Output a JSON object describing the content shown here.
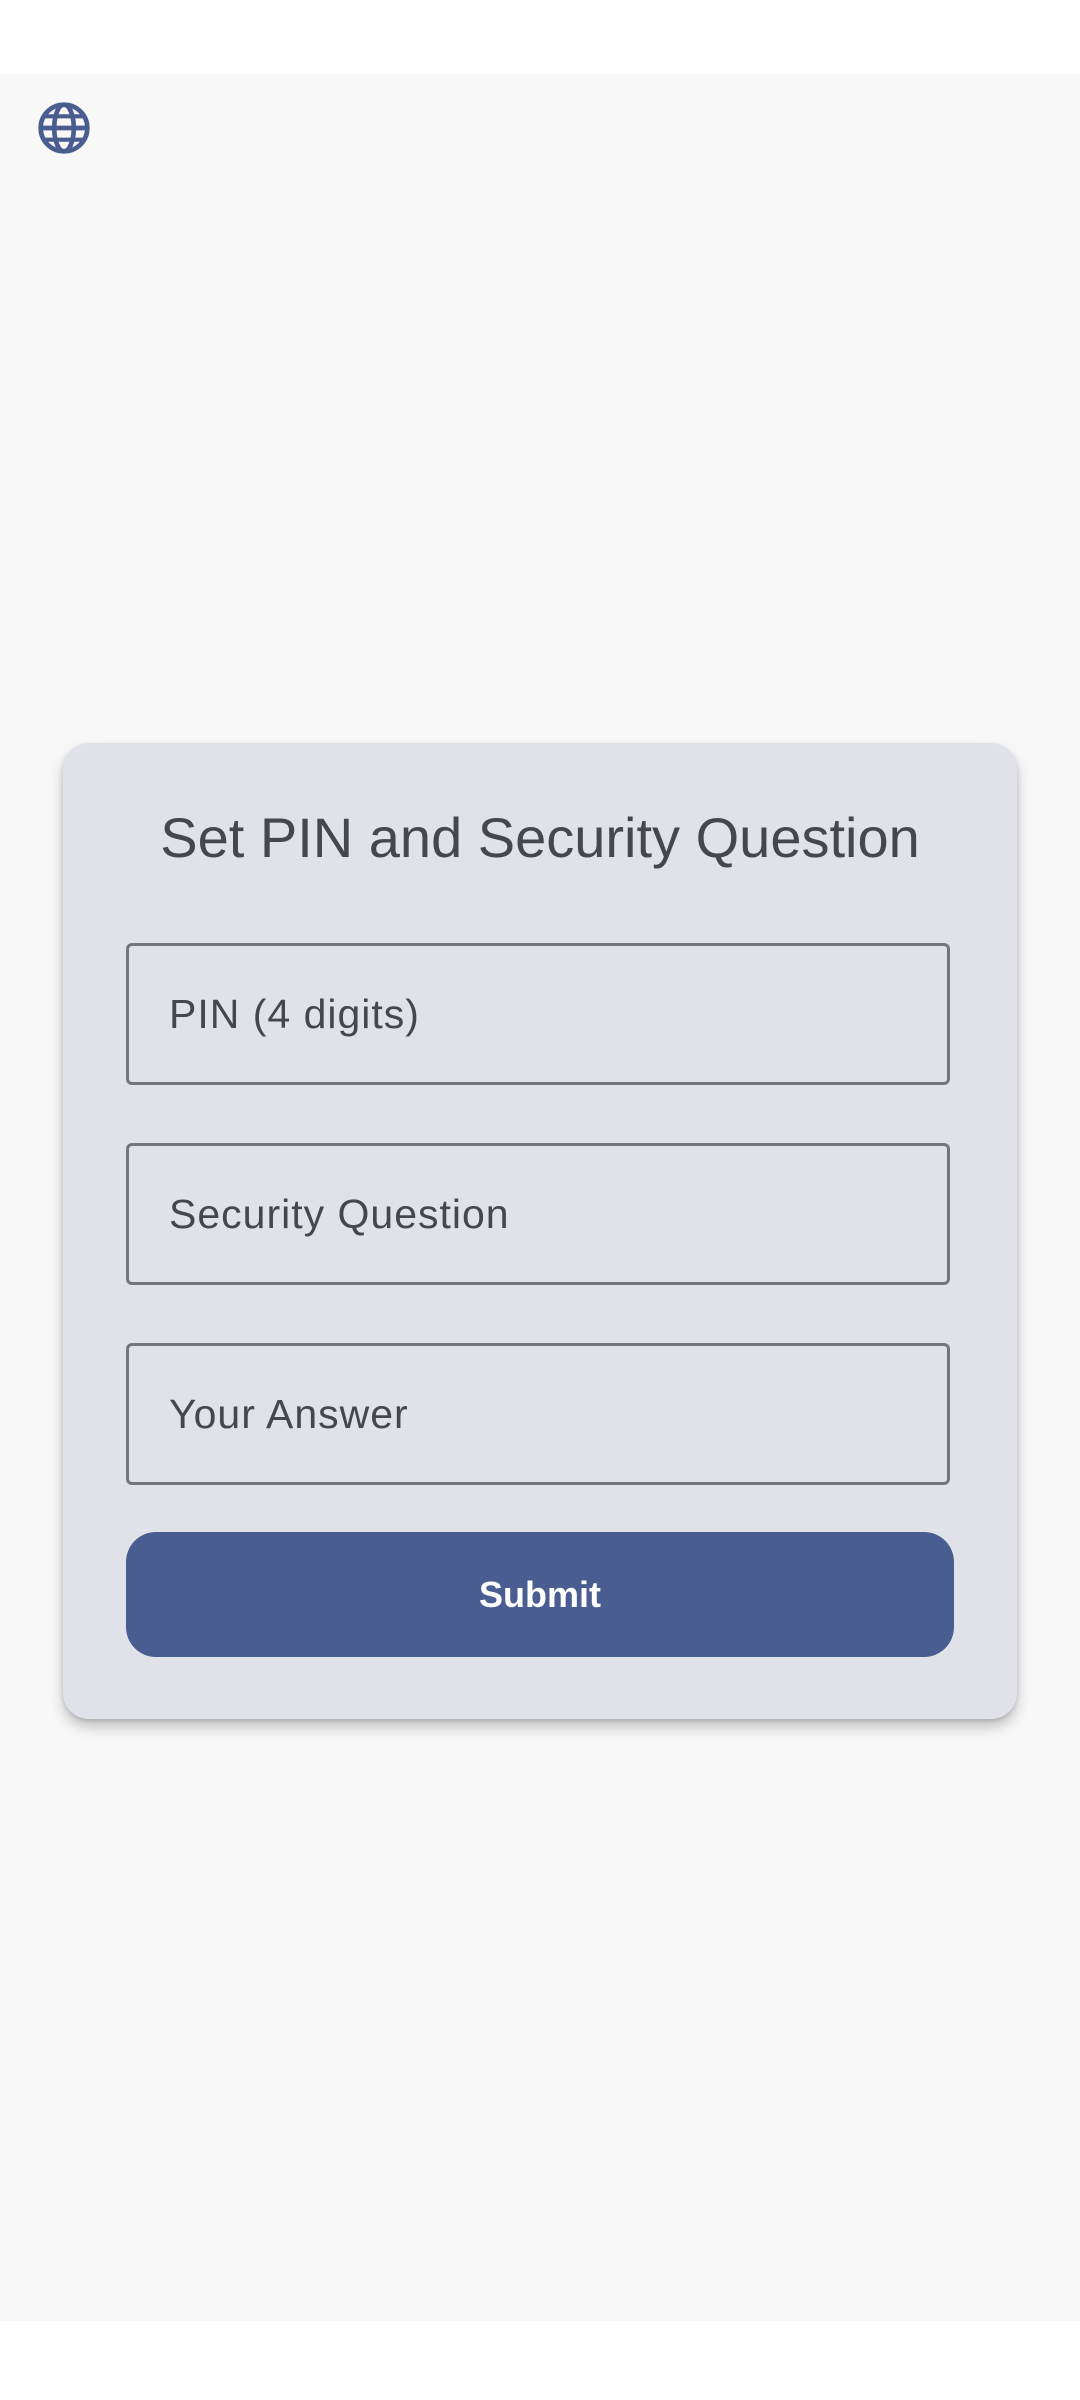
{
  "colors": {
    "background": "#f8f8f8",
    "card": "#e1e1ea",
    "primary": "#495d91",
    "text": "#45464f",
    "outline": "#74757f"
  },
  "header": {
    "language_icon": "globe-icon"
  },
  "form": {
    "title": "Set PIN and Security Question",
    "pin_field": {
      "label": "PIN (4 digits)",
      "value": ""
    },
    "question_field": {
      "label": "Security Question",
      "value": ""
    },
    "answer_field": {
      "label": "Your Answer",
      "value": ""
    },
    "submit_label": "Submit"
  }
}
